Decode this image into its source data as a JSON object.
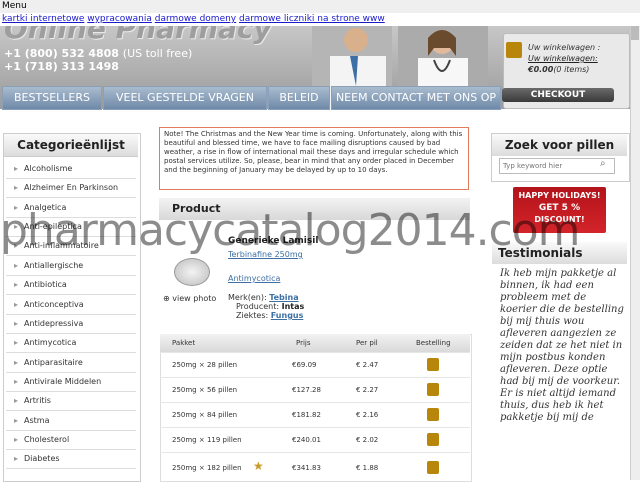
{
  "menubar": {
    "label": "Menu"
  },
  "adlinks": [
    "kartki internetowe",
    "wypracowania",
    "darmowe domeny",
    "darmowe liczniki na strone www"
  ],
  "header": {
    "logo": "Online Pharmacy",
    "phone1": "+1 (800) 532 4808",
    "phone1_note": "(US toll free)",
    "phone2": "+1 (718) 313 1498"
  },
  "cart": {
    "label": "Uw winkelwagen :",
    "link": "Uw winkelwagen:",
    "amount": "€0.00",
    "items": "(0 items)",
    "checkout": "CHECKOUT"
  },
  "nav": [
    "BESTSELLERS",
    "VEEL GESTELDE VRAGEN",
    "BELEID",
    "NEEM CONTACT MET ONS OP"
  ],
  "categories": {
    "title": "Categorieënlijst",
    "items": [
      "Alcoholisme",
      "Alzheimer En Parkinson",
      "Analgetica",
      "Anti-epileptica",
      "Anti-inflammatoire",
      "Antiallergische",
      "Antibiotica",
      "Anticonceptiva",
      "Antidepressiva",
      "Antimycotica",
      "Antiparasitaire",
      "Antivirale Middelen",
      "Artritis",
      "Astma",
      "Cholesterol",
      "Diabetes"
    ]
  },
  "note": "Note! The Christmas and the New Year time is coming. Unfortunately, along with this beautiful and blessed time, we have to face mailing disruptions caused by bad weather, a rise in flow of international mail these days and irregular schedule which postal services utilize. So, please, bear in mind that any order placed in December and the beginning of January may be delayed by up to 10 days.",
  "product": {
    "header": "Product",
    "name": "Generieke Lamisil",
    "link1": "Terbinafine 250mg",
    "link2": "Antimycotica",
    "view_photo": "view photo",
    "brand_label": "Merk(en):",
    "brand": "Tebina",
    "producer_label": "Producent:",
    "producer": "Intas",
    "disease_label": "Ziektes:",
    "disease": "Fungus"
  },
  "table": {
    "headers": [
      "Pakket",
      "Prijs",
      "Per pil",
      "Bestelling"
    ],
    "rows": [
      {
        "pakket": "250mg × 28 pillen",
        "prijs": "€69.09",
        "perpil": "€ 2.47"
      },
      {
        "pakket": "250mg × 56 pillen",
        "prijs": "€127.28",
        "perpil": "€ 2.27"
      },
      {
        "pakket": "250mg × 84 pillen",
        "prijs": "€181.82",
        "perpil": "€ 2.16"
      },
      {
        "pakket": "250mg × 119 pillen",
        "prijs": "€240.01",
        "perpil": "€ 2.02"
      },
      {
        "pakket": "250mg × 182 pillen",
        "prijs": "€341.83",
        "perpil": "€ 1.88"
      }
    ]
  },
  "search": {
    "title": "Zoek voor pillen",
    "placeholder": "Typ keyword hier"
  },
  "banner": {
    "line1": "HAPPY HOLIDAYS!",
    "line2": "GET 5 %",
    "line3": "DISCOUNT!"
  },
  "testimonials": {
    "title": "Testimonials",
    "text": "Ik heb mijn pakketje al binnen, ik had een probleem met de koerier die de bestelling bij mij thuis wou afleveren aangezien ze zeiden dat ze het niet in mijn postbus konden afleveren. Deze optie had bij mij de voorkeur. Er is niet altijd iemand thuis, dus heb ik het pakketje bij mij de"
  },
  "watermark": "pharmacycatalog2014.com",
  "colors": {
    "nav": "#7f97b3",
    "accent": "#3d6fa4",
    "note_border": "#e07b5b",
    "banner": "#c41c22"
  }
}
